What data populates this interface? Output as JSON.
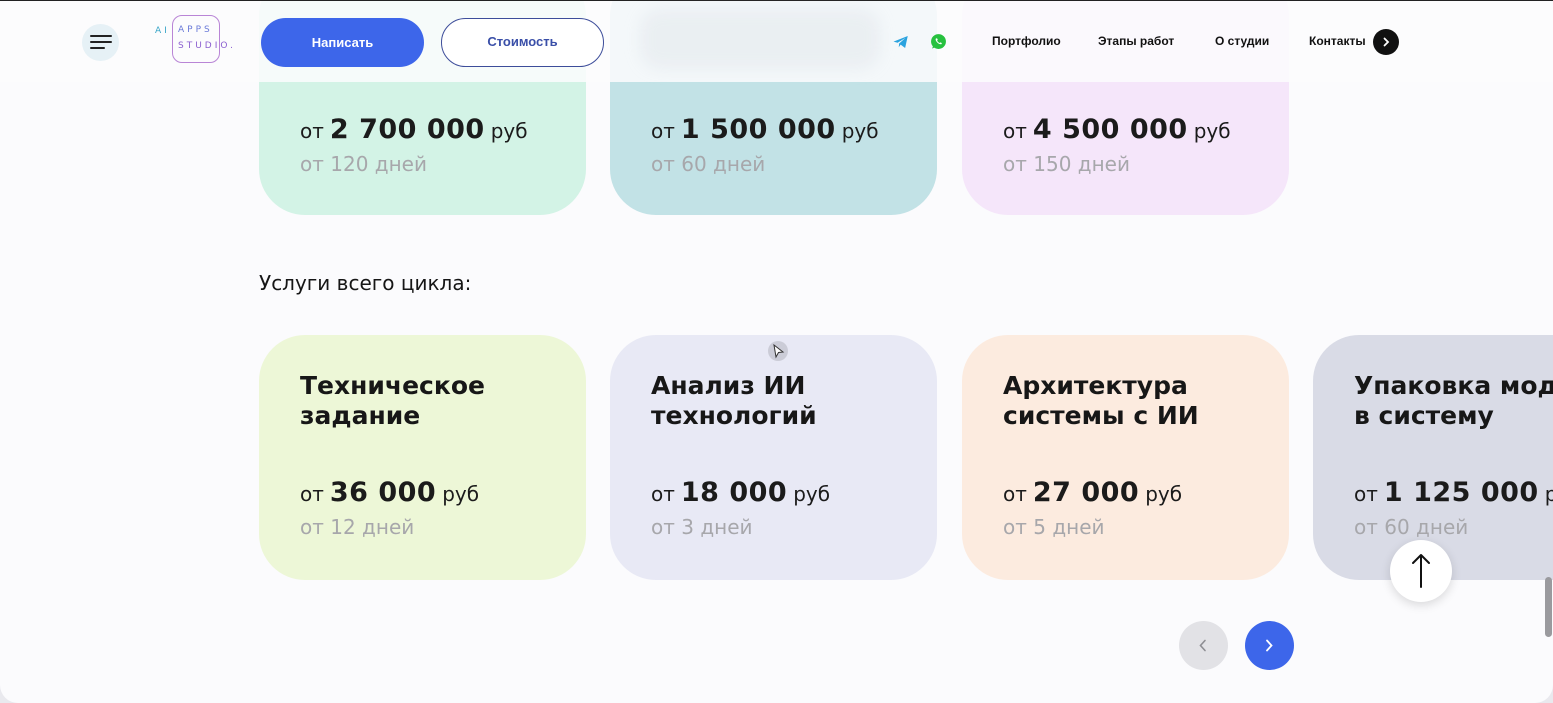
{
  "header": {
    "logo": {
      "line1": "AI",
      "line2": "APPS",
      "line3": "STUDIO."
    },
    "write_button": "Написать",
    "cost_button": "Стоимость",
    "nav": [
      {
        "label": "Портфолио"
      },
      {
        "label": "Этапы работ"
      },
      {
        "label": "О студии"
      },
      {
        "label": "Контакты"
      }
    ],
    "icons": {
      "telegram": "telegram-icon",
      "whatsapp": "whatsapp-icon",
      "menu": "hamburger-menu-icon"
    }
  },
  "top_cards": [
    {
      "prefix": "от",
      "amount": "2 700 000",
      "currency": "руб",
      "days": "от 120 дней",
      "color": "#d3f3e6"
    },
    {
      "prefix": "от",
      "amount": "1 500 000",
      "currency": "руб",
      "days": "от 60 дней",
      "color": "#c2e2e6"
    },
    {
      "prefix": "от",
      "amount": "4 500 000",
      "currency": "руб",
      "days": "от 150 дней",
      "color": "#f5e6fa"
    }
  ],
  "section": {
    "title": "Услуги всего цикла:"
  },
  "cards": [
    {
      "title": "Техническое\nзадание",
      "prefix": "от",
      "amount": "36 000",
      "currency": "руб",
      "days": "от 12 дней",
      "color": "#edf7d7"
    },
    {
      "title": "Анализ ИИ\nтехнологий",
      "prefix": "от",
      "amount": "18 000",
      "currency": "руб",
      "days": "от 3 дней",
      "color": "#e8e9f5"
    },
    {
      "title": "Архитектура\nсистемы с ИИ",
      "prefix": "от",
      "amount": "27 000",
      "currency": "руб",
      "days": "от 5 дней",
      "color": "#fcebdf"
    },
    {
      "title": "Упаковка модуля\nв систему",
      "prefix": "от",
      "amount": "1 125 000",
      "currency": "руб",
      "days": "от 60 дней",
      "color": "#d9dbe6"
    }
  ],
  "colors": {
    "accent": "#3d66ea"
  }
}
